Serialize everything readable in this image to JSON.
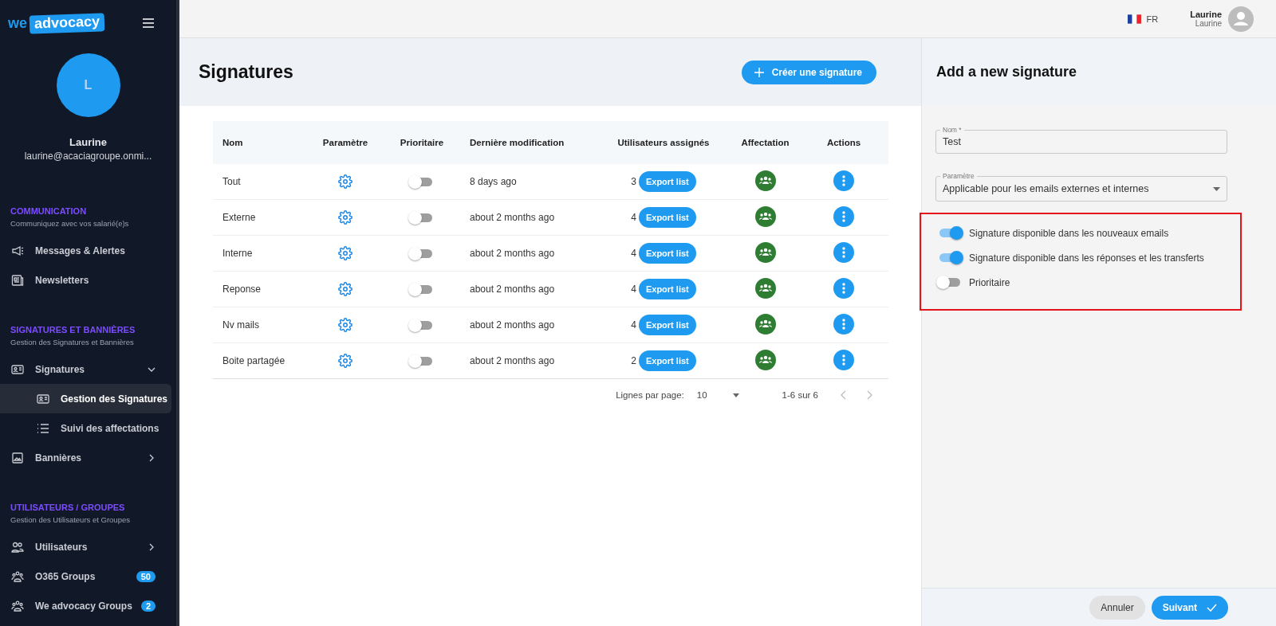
{
  "sidebar": {
    "logo": {
      "prefix": "we",
      "word": "advocacy"
    },
    "user": {
      "initial": "L",
      "name": "Laurine",
      "email": "laurine@acaciagroupe.onmi..."
    },
    "sections": [
      {
        "title": "COMMUNICATION",
        "subtitle": "Communiquez avec vos salarié(e)s",
        "items": [
          {
            "label": "Messages & Alertes",
            "kind": "link",
            "selected": false
          },
          {
            "label": "Newsletters",
            "kind": "link",
            "selected": false
          }
        ]
      },
      {
        "title": "SIGNATURES ET BANNIÈRES",
        "subtitle": "Gestion des Signatures et Bannières",
        "items": [
          {
            "label": "Signatures",
            "kind": "group",
            "expanded": true,
            "selected": false,
            "children": [
              {
                "label": "Gestion des Signatures",
                "selected": true
              },
              {
                "label": "Suivi des affectations",
                "selected": false
              }
            ]
          },
          {
            "label": "Bannières",
            "kind": "group",
            "expanded": false,
            "selected": false
          }
        ]
      },
      {
        "title": "UTILISATEURS / GROUPES",
        "subtitle": "Gestion des Utilisateurs et Groupes",
        "items": [
          {
            "label": "Utilisateurs",
            "kind": "group",
            "expanded": false,
            "selected": false
          },
          {
            "label": "O365 Groups",
            "kind": "link",
            "selected": false,
            "badge": "50"
          },
          {
            "label": "We advocacy Groups",
            "kind": "link",
            "selected": false,
            "badge": "2"
          }
        ]
      }
    ]
  },
  "topbar": {
    "language": "FR",
    "user_name": "Laurine",
    "user_subtitle": "Laurine"
  },
  "page": {
    "title": "Signatures",
    "create_button": "Créer une signature"
  },
  "table": {
    "columns": [
      "Nom",
      "Paramètre",
      "Prioritaire",
      "Dernière modification",
      "Utilisateurs assignés",
      "Affectation",
      "Actions"
    ],
    "rows": [
      {
        "name": "Tout",
        "prioritaire": false,
        "modified": "8 days ago",
        "users": "3",
        "export": "Export list"
      },
      {
        "name": "Externe",
        "prioritaire": false,
        "modified": "about 2 months ago",
        "users": "4",
        "export": "Export list"
      },
      {
        "name": "Interne",
        "prioritaire": false,
        "modified": "about 2 months ago",
        "users": "4",
        "export": "Export list"
      },
      {
        "name": "Reponse",
        "prioritaire": false,
        "modified": "about 2 months ago",
        "users": "4",
        "export": "Export list"
      },
      {
        "name": "Nv mails",
        "prioritaire": false,
        "modified": "about 2 months ago",
        "users": "4",
        "export": "Export list"
      },
      {
        "name": "Boite partagée",
        "prioritaire": false,
        "modified": "about 2 months ago",
        "users": "2",
        "export": "Export list"
      }
    ],
    "pagination": {
      "rows_label": "Lignes par page:",
      "rows_per_page": "10",
      "range": "1-6 sur 6"
    }
  },
  "panel": {
    "title": "Add a new signature",
    "name_field": {
      "label": "Nom *",
      "value": "Test"
    },
    "param_field": {
      "label": "Paramètre",
      "value": "Applicable pour les emails externes et internes"
    },
    "toggles_highlighted": true,
    "toggles": [
      {
        "label": "Signature disponible dans les nouveaux emails",
        "on": true
      },
      {
        "label": "Signature disponible dans les réponses et les transferts",
        "on": true
      },
      {
        "label": "Prioritaire",
        "on": false
      }
    ],
    "cancel_button": "Annuler",
    "next_button": "Suivant"
  }
}
